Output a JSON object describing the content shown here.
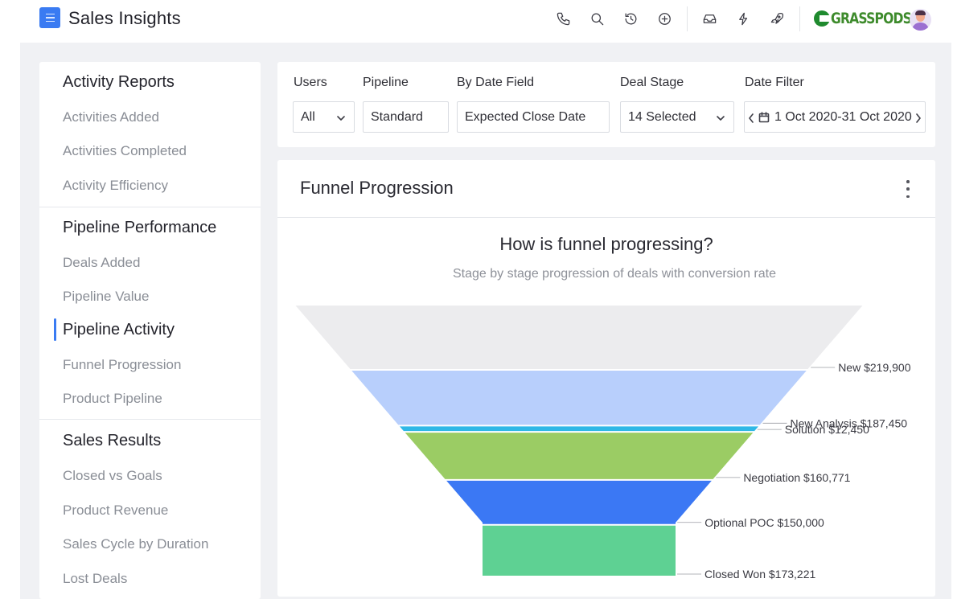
{
  "header": {
    "app_title": "Sales Insights",
    "menu_icon": "menu-icon",
    "icons": [
      "phone-icon",
      "search-icon",
      "history-icon",
      "add-circle-icon",
      "inbox-icon",
      "lightning-icon",
      "rocket-icon"
    ],
    "brand": "GRASSPODS"
  },
  "sidebar": {
    "groups": [
      {
        "heading": "Activity Reports",
        "items": [
          "Activities Added",
          "Activities Completed",
          "Activity Efficiency"
        ]
      },
      {
        "heading": "Pipeline Performance",
        "items": [
          "Deals Added",
          "Pipeline Value",
          "Pipeline Activity",
          "Funnel Progression",
          "Product Pipeline"
        ]
      },
      {
        "heading": "Sales Results",
        "items": [
          "Closed vs Goals",
          "Product Revenue",
          "Sales Cycle by Duration",
          "Lost Deals"
        ]
      }
    ],
    "active_item": "Pipeline Activity"
  },
  "filters": {
    "users": {
      "label": "Users",
      "value": "All"
    },
    "pipeline": {
      "label": "Pipeline",
      "value": "Standard"
    },
    "date_field": {
      "label": "By Date Field",
      "value": "Expected Close Date"
    },
    "deal_stage": {
      "label": "Deal Stage",
      "value": "14 Selected"
    },
    "date_filter": {
      "label": "Date Filter",
      "value": "1 Oct 2020-31 Oct 2020"
    }
  },
  "card": {
    "title": "Funnel Progression"
  },
  "chart_data": {
    "type": "funnel",
    "title": "How is funnel progressing?",
    "subtitle": "Stage by stage progression of deals with conversion rate",
    "stages": [
      {
        "label": "New $219,900",
        "value": 219900,
        "color": "#ececee"
      },
      {
        "label": "New Analysis $187,450",
        "value": 187450,
        "color": "#b8cffc"
      },
      {
        "label": "Solution $12,450",
        "value": 12450,
        "color": "#2fb8e6"
      },
      {
        "label": "Negotiation $160,771",
        "value": 160771,
        "color": "#9bcc64"
      },
      {
        "label": "Optional POC $150,000",
        "value": 150000,
        "color": "#3b78f4"
      },
      {
        "label": "Closed Won $173,221",
        "value": 173221,
        "color": "#5ed193"
      }
    ]
  }
}
